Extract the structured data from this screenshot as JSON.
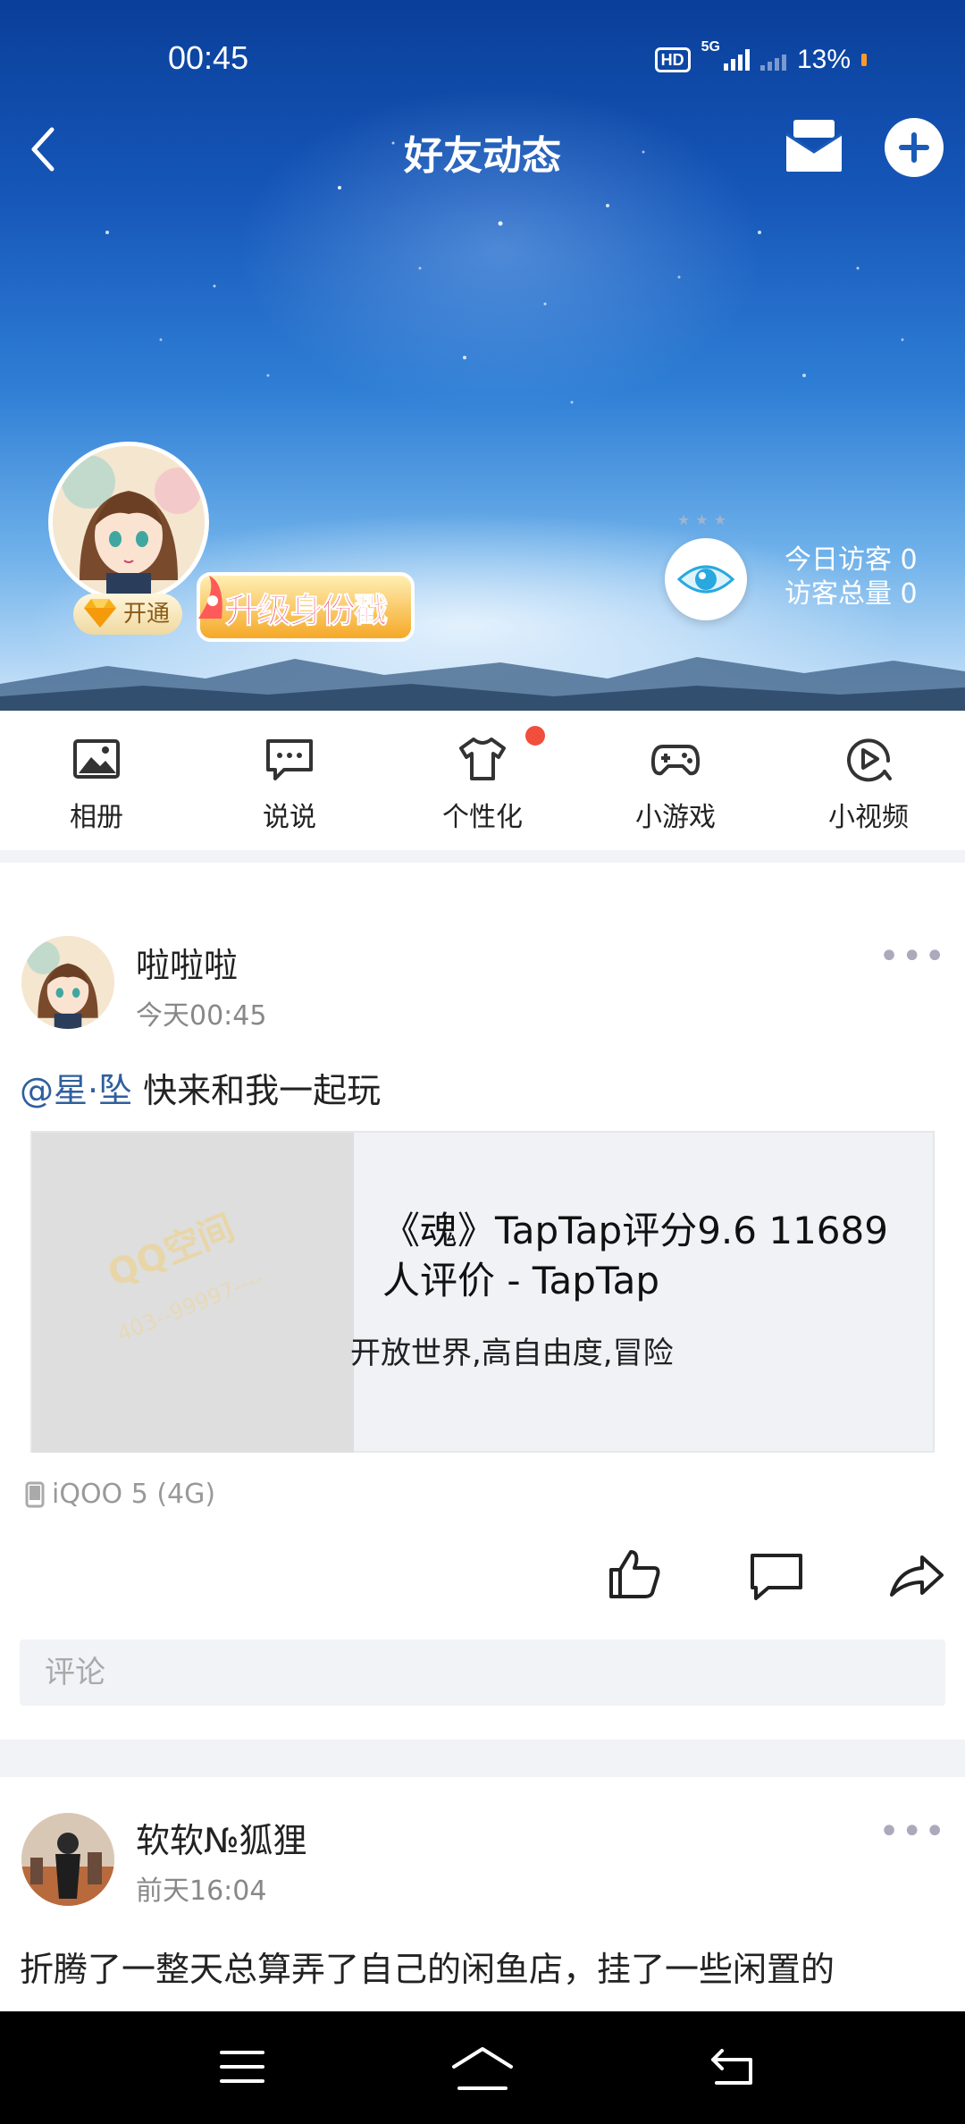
{
  "status": {
    "time": "00:45",
    "hd": "HD",
    "net": "5G",
    "battery": "13%"
  },
  "header": {
    "title": "好友动态"
  },
  "profile": {
    "vip_label": "开通",
    "upgrade_text": "升级身份戳"
  },
  "visitors": {
    "today_label": "今日访客",
    "today_count": "0",
    "total_label": "访客总量",
    "total_count": "0"
  },
  "actions": [
    {
      "label": "相册",
      "icon": "photo-album-icon"
    },
    {
      "label": "说说",
      "icon": "speech-bubble-icon"
    },
    {
      "label": "个性化",
      "icon": "tshirt-icon"
    },
    {
      "label": "小游戏",
      "icon": "gamepad-icon"
    },
    {
      "label": "小视频",
      "icon": "video-play-icon"
    }
  ],
  "posts": [
    {
      "author": "啦啦啦",
      "time": "今天00:45",
      "mention": "@星·坠",
      "text": " 快来和我一起玩",
      "card": {
        "title": "《魂》TapTap评分9.6 11689人评价 - TapTap",
        "desc": "开放世界,高自由度,冒险",
        "watermark": "QQ空间",
        "watermark_sub": "403--99997----"
      },
      "device": "iQOO 5 (4G)",
      "comment_placeholder": "评论"
    },
    {
      "author": "软软№狐狸",
      "time": "前天16:04",
      "text": "折腾了一整天总算弄了自己的闲鱼店，挂了一些闲置的"
    }
  ],
  "colors": {
    "accent": "#2f5f9e",
    "badge": "#f24e3c"
  }
}
